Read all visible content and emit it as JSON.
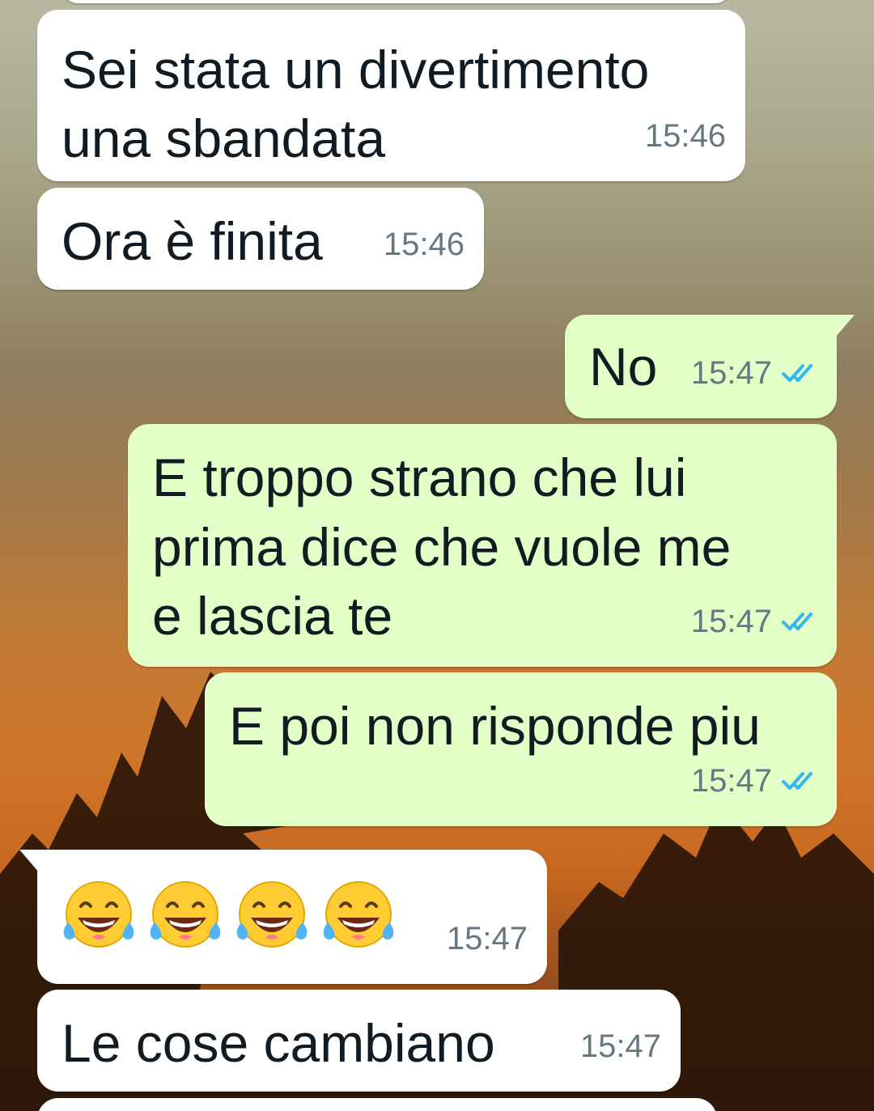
{
  "messages": [
    {
      "direction": "incoming",
      "lines": [
        "Sei stata un divertimento",
        "una sbandata"
      ],
      "time": "15:46"
    },
    {
      "direction": "incoming",
      "lines": [
        "Ora è finita"
      ],
      "time": "15:46"
    },
    {
      "direction": "outgoing",
      "lines": [
        "No"
      ],
      "time": "15:47",
      "status": "read-double-check"
    },
    {
      "direction": "outgoing",
      "lines": [
        "E troppo strano che lui",
        "prima dice che vuole me",
        "e lascia te"
      ],
      "time": "15:47",
      "status": "read-double-check"
    },
    {
      "direction": "outgoing",
      "lines": [
        "E poi non risponde piu"
      ],
      "time": "15:47",
      "status": "read-double-check"
    },
    {
      "direction": "incoming",
      "emoji": [
        "face-with-tears-of-joy",
        "face-with-tears-of-joy",
        "face-with-tears-of-joy",
        "face-with-tears-of-joy"
      ],
      "time": "15:47"
    },
    {
      "direction": "incoming",
      "lines": [
        "Le cose cambiano"
      ],
      "time": "15:47"
    }
  ],
  "colors": {
    "incoming_bubble": "#ffffff",
    "outgoing_bubble": "#e2ffc7",
    "text": "#111b21",
    "timestamp": "#667781",
    "read_ticks": "#34b7f1"
  }
}
